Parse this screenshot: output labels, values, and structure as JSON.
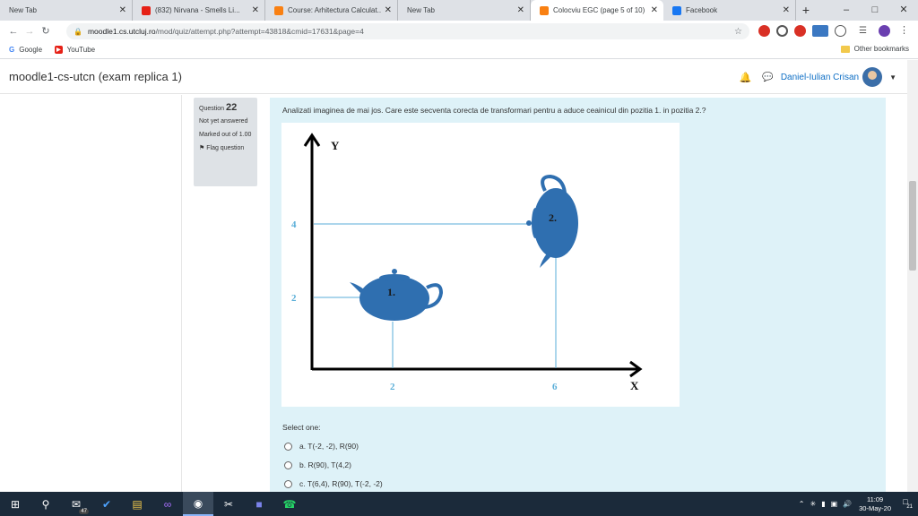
{
  "browser": {
    "tabs": [
      {
        "title": "New Tab",
        "icon": "blank-icon",
        "active": false
      },
      {
        "title": "(832) Nirvana - Smells Li...",
        "icon": "youtube-icon",
        "active": false
      },
      {
        "title": "Course: Arhitectura Calculat...",
        "icon": "moodle-icon",
        "active": false
      },
      {
        "title": "New Tab",
        "icon": "blank-icon",
        "active": false
      },
      {
        "title": "Colocviu EGC (page 5 of 10)",
        "icon": "moodle-icon",
        "active": true
      },
      {
        "title": "Facebook",
        "icon": "facebook-icon",
        "active": false
      }
    ],
    "newtab_symbol": "+",
    "url_host": "moodle1.cs.utcluj.ro",
    "url_path": "/mod/quiz/attempt.php?attempt=43818&cmid=17631&page=4",
    "bookmarks": [
      {
        "label": "Google",
        "icon": "google-icon"
      },
      {
        "label": "YouTube",
        "icon": "youtube-icon"
      }
    ],
    "other_bookmarks": "Other bookmarks"
  },
  "page": {
    "site_title": "moodle1-cs-utcn (exam replica 1)",
    "user_name": "Daniel-Iulian Crisan"
  },
  "question": {
    "label": "Question",
    "number": "22",
    "state": "Not yet answered",
    "marks": "Marked out of 1.00",
    "flag": "Flag question",
    "text": "Analizati imaginea de mai jos. Care este secventa corecta de transformari pentru a aduce ceainicul din pozitia 1. in pozitia 2.?",
    "select_label": "Select one:",
    "options": [
      {
        "label": "a. T(-2, -2), R(90)"
      },
      {
        "label": "b. R(90), T(4,2)"
      },
      {
        "label": "c. T(6,4), R(90), T(-2, -2)"
      }
    ]
  },
  "figure": {
    "y_axis": "Y",
    "x_axis": "X",
    "y_tick_upper": "4",
    "y_tick_lower": "2",
    "x_tick_left": "2",
    "x_tick_right": "6",
    "label_pos1": "1.",
    "label_pos2": "2.",
    "teapot_color": "#2f6fb0",
    "guide_color": "#5aaed8"
  },
  "taskbar": {
    "mail_badge": "47",
    "time": "11:09",
    "date": "30-May-20",
    "notif_count": "21"
  }
}
